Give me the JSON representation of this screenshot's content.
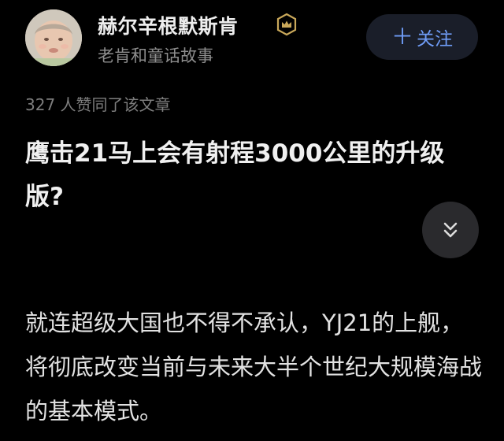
{
  "author": {
    "name": "赫尔辛根默斯肯",
    "subtitle": "老肯和童话故事",
    "avatar_icon": "baby-photo-avatar",
    "badge_icon": "crown-badge-icon"
  },
  "follow": {
    "plus": "＋",
    "label": "关注"
  },
  "stats": {
    "likes": "327",
    "likes_text": " 人赞同了该文章"
  },
  "article": {
    "title": "鹰击21马上会有射程3000公里的升级版?",
    "body": "就连超级大国也不得不承认，YJ21的上舰，将彻底改变当前与未来大半个世纪大规模海战的基本模式。"
  },
  "controls": {
    "collapse_icon": "double-chevron-down-icon"
  },
  "colors": {
    "background": "#000000",
    "follow_text": "#6f9cf6",
    "follow_bg": "#1a1e29",
    "badge": "#c9a85a"
  }
}
